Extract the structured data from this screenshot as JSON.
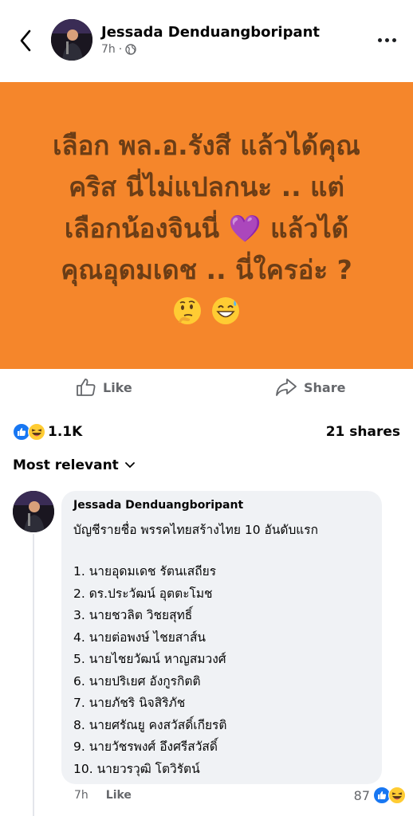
{
  "post": {
    "author": "Jessada Denduangboripant",
    "time": "7h",
    "separator": "·",
    "banner_lines": [
      "เลือก พล.อ.รังสี แล้วได้คุณ",
      "คริส นี่ไม่แปลกนะ .. แต่",
      "เลือกน้องจินนี่ 💜 แล้วได้",
      "คุณอุดมเดช .. นี่ใครอ่ะ ?"
    ],
    "banner_emojis": [
      "thinking-face",
      "grinning-face-with-sweat"
    ],
    "banner_bg": "#f5862b",
    "banner_text_color": "#6b3d16"
  },
  "actions": {
    "like": "Like",
    "share": "Share"
  },
  "stats": {
    "reaction_count": "1.1K",
    "shares": "21 shares",
    "reaction_icons": [
      "like-reaction",
      "haha-reaction"
    ]
  },
  "sort": {
    "label": "Most relevant"
  },
  "comment": {
    "author": "Jessada Denduangboripant",
    "intro": "บัญชีรายชื่อ พรรคไทยสร้างไทย 10 อันดับแรก",
    "list": [
      "1. นายอุดมเดช รัตนเสถียร",
      "2. ดร.ประวัฒน์ อุตตะโมช",
      "3. นายชวลิต วิชยสุทธิ์",
      "4. นายต่อพงษ์ ไชยสาส์น",
      "5. นายไชยวัฒน์ หาญสมวงศ์",
      "6. นายปริเยศ อังกูรกิตติ",
      "7. นายภัชริ นิจสิริภัช",
      "8. นายศรัณยู คงสวัสดิ์เกียรติ",
      "9. นายวัชรพงศ์ อึงศรีสวัสดิ์",
      "10. นายวรวุฒิ โตวิรัตน์"
    ],
    "time": "7h",
    "like": "Like",
    "reaction_count": "87"
  },
  "colors": {
    "facebook_blue": "#1877f2",
    "secondary_text": "#65676b",
    "bubble_bg": "#f0f2f5"
  }
}
